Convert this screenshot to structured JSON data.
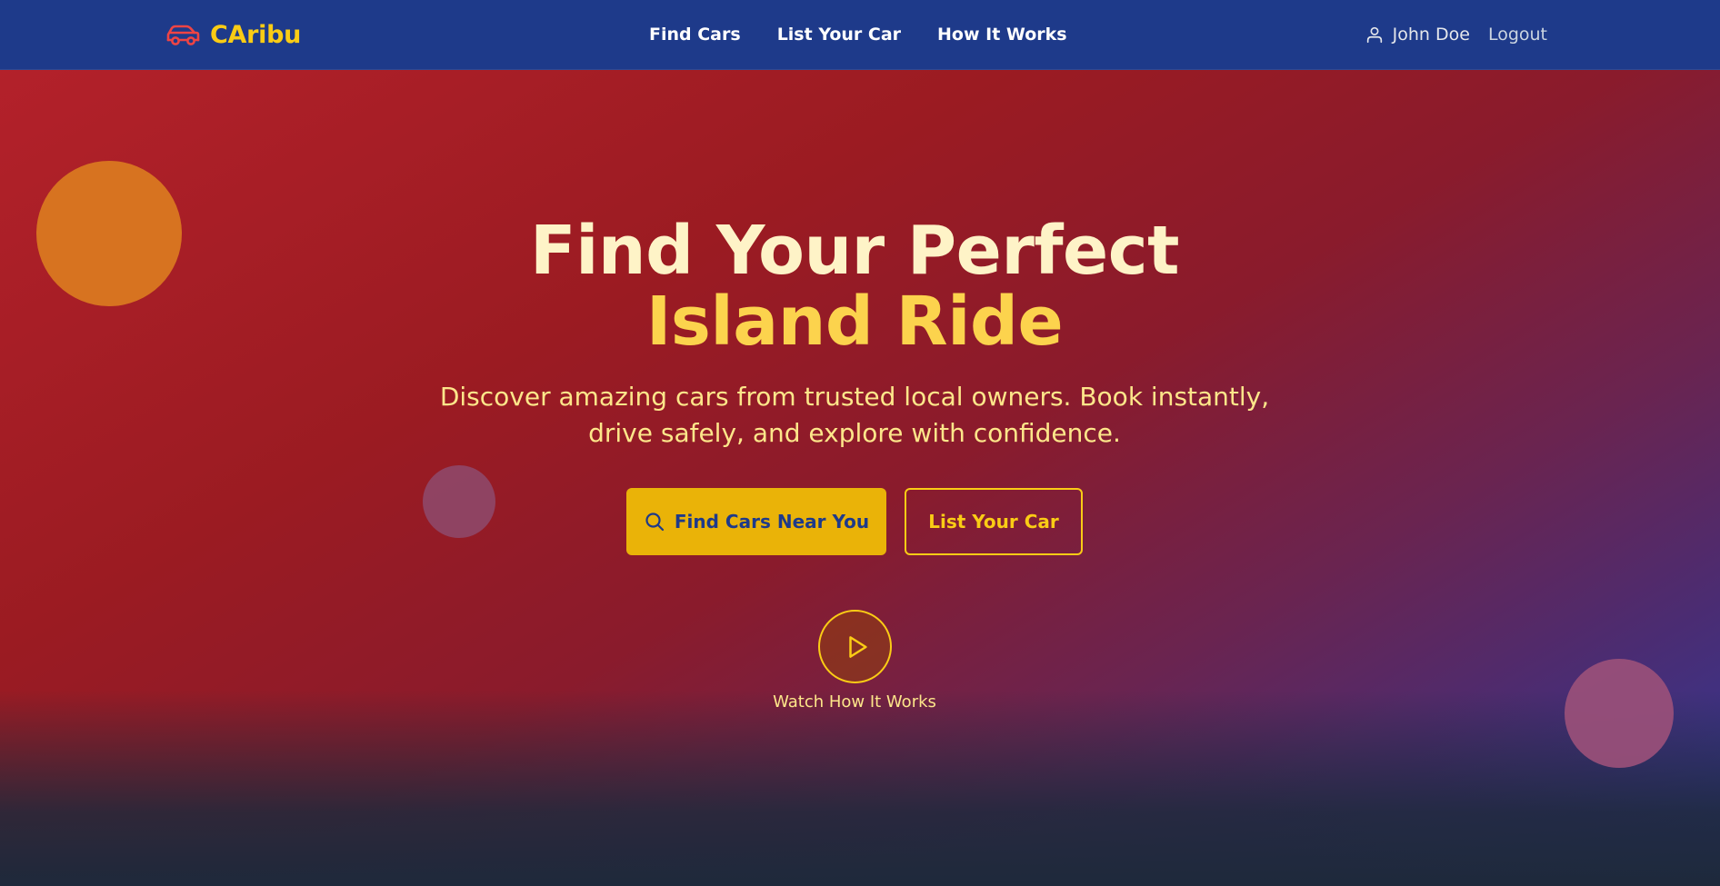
{
  "nav": {
    "brand": "CAribu",
    "links": [
      "Find Cars",
      "List Your Car",
      "How It Works"
    ],
    "user_name": "John Doe",
    "logout": "Logout"
  },
  "hero": {
    "title_line1": "Find Your Perfect",
    "title_line2": "Island Ride",
    "subtitle": "Discover amazing cars from trusted local owners. Book instantly, drive safely, and explore with confidence.",
    "primary_cta": "Find Cars Near You",
    "secondary_cta": "List Your Car",
    "watch_label": "Watch How It Works"
  },
  "icons": {
    "logo": "car-icon",
    "user": "user-icon",
    "search": "search-icon",
    "play": "play-icon"
  },
  "colors": {
    "navbar": "#1e3a8a",
    "accent_yellow": "#facc15",
    "button_yellow": "#eab308",
    "logo_red": "#ef4444",
    "hero_red": "#b3212a",
    "hero_blue": "#2d3a9a"
  }
}
